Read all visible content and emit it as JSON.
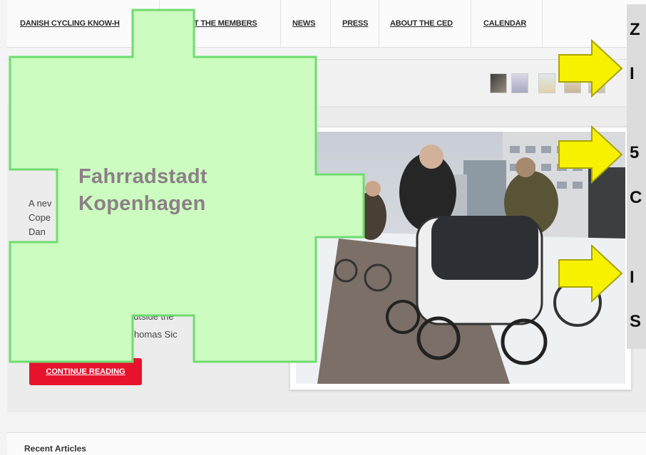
{
  "nav": {
    "items": [
      "DANISH CYCLING KNOW-H",
      "T THE MEMBERS",
      "NEWS",
      "PRESS",
      "ABOUT THE CED",
      "CALENDAR"
    ]
  },
  "article": {
    "lines": [
      "A nev",
      "Cope",
      "Dan"
    ],
    "fragment_1": "outside the",
    "fragment_2": "Thomas Sic",
    "continue_label": "CONTINUE READING"
  },
  "recent": {
    "label": "Recent Articles"
  },
  "overlay": {
    "title_line1": "Fahrradstadt",
    "title_line2": "Kopenhagen",
    "right_chars": [
      "Z",
      "I",
      "5",
      "C",
      "I",
      "S"
    ]
  },
  "colors": {
    "puzzle_fill": "#ccfcc0",
    "puzzle_edge": "#6fdc6f",
    "arrow_fill": "#f7f100",
    "cta_red": "#e7132d"
  },
  "icons": {
    "arrow": "right-arrow-icon"
  }
}
